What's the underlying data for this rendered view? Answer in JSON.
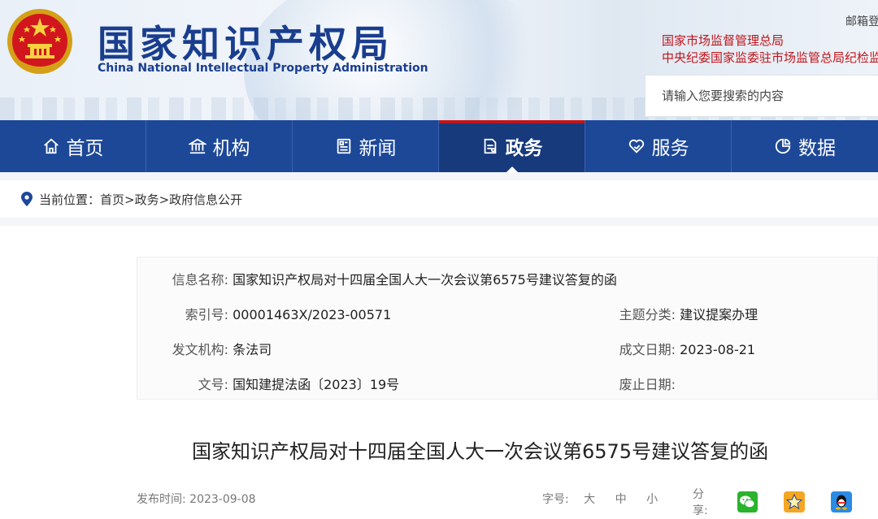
{
  "header": {
    "title": "国家知识产权局",
    "subtitle": "China National Intellectual Property Administration",
    "mail_link": "邮箱登录",
    "external_links": [
      "国家市场监督管理总局",
      "中央纪委国家监委驻市场监管总局纪检监察组"
    ],
    "search_placeholder": "请输入您要搜索的内容"
  },
  "nav": {
    "items": [
      {
        "label": "首页",
        "icon": "home-icon"
      },
      {
        "label": "机构",
        "icon": "building-icon"
      },
      {
        "label": "新闻",
        "icon": "newspaper-icon"
      },
      {
        "label": "政务",
        "icon": "document-icon",
        "active": true
      },
      {
        "label": "服务",
        "icon": "heart-hand-icon"
      },
      {
        "label": "数据",
        "icon": "pie-chart-icon"
      }
    ]
  },
  "breadcrumb": {
    "label": "当前位置：",
    "path": "首页>政务>政府信息公开"
  },
  "info": {
    "name_label": "信息名称:",
    "name_value": "国家知识产权局对十四届全国人大一次会议第6575号建议答复的函",
    "index_label": "索引号:",
    "index_value": "00001463X/2023-00571",
    "topic_label": "主题分类:",
    "topic_value": "建议提案办理",
    "issuer_label": "发文机构:",
    "issuer_value": "条法司",
    "date_label": "成文日期:",
    "date_value": "2023-08-21",
    "docno_label": "文号:",
    "docno_value": "国知建提法函〔2023〕19号",
    "abolish_label": "废止日期:",
    "abolish_value": ""
  },
  "article": {
    "title": "国家知识产权局对十四届全国人大一次会议第6575号建议答复的函",
    "publish_label": "发布时间:",
    "publish_date": "2023-09-08",
    "font_label": "字号:",
    "font_large": "大",
    "font_medium": "中",
    "font_small": "小",
    "share_label": "分享:"
  },
  "colors": {
    "brand_blue": "#1d4898",
    "active_nav": "#163a7c",
    "accent_red": "#c0151b"
  }
}
